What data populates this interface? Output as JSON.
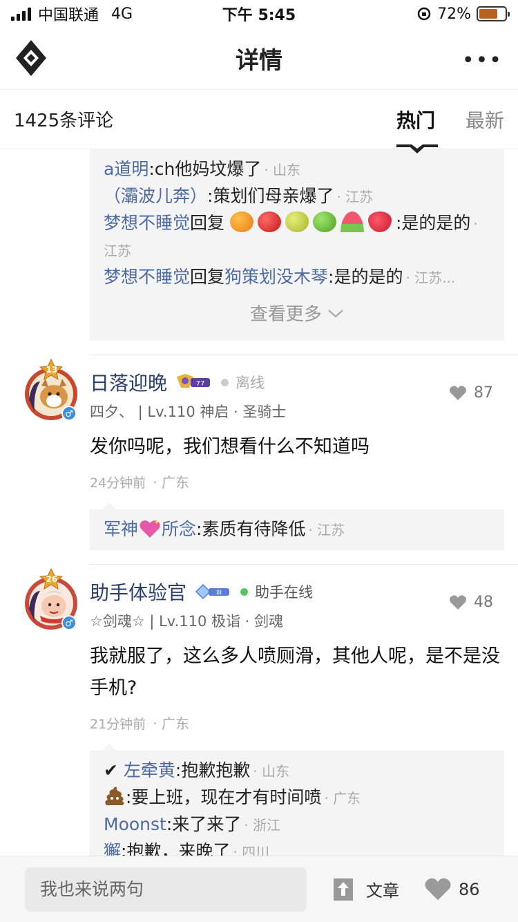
{
  "status_bar": {
    "carrier": "中国联通",
    "network": "4G",
    "time": "下午 5:45",
    "battery_percent": "72%",
    "battery_level": 0.72
  },
  "nav": {
    "title": "详情",
    "more": "•••"
  },
  "comments_header": {
    "count": "1425条评论",
    "tabs": [
      "热门",
      "最新"
    ],
    "active_tab": "热门"
  },
  "prev_replies": {
    "lines": [
      {
        "user": "a道明",
        "text": ":ch他妈坟爆了",
        "loc": "· 山东"
      },
      {
        "user": "（灞波儿奔）",
        "text": ":策划们母亲爆了",
        "loc": "· 江苏"
      },
      {
        "user": "梦想不睡觉",
        "mid": "回复",
        "emojis": [
          "orange",
          "apple",
          "pear",
          "green-apple",
          "watermelon",
          "strawberry"
        ],
        "text": ":是的是的",
        "loc": "· 江苏"
      },
      {
        "user": "梦想不睡觉",
        "mid": "回复",
        "target": "狗策划没木琴",
        "text": ":是的是的",
        "loc": "· 江苏..."
      }
    ],
    "see_more": "查看更多"
  },
  "comments": [
    {
      "avatar_level": "13",
      "name": "日落迎晚",
      "badge": "77",
      "status": "离线",
      "status_color": "#cccccc",
      "rank": "四夕、 | Lv.110 神启 · 圣骑士",
      "likes": "87",
      "content": "发你吗呢，我们想看什么不知道吗",
      "time": "24分钟前",
      "loc": "· 广东",
      "replies": [
        {
          "user": "军神",
          "emoji": "sparkle-heart",
          "user2": "所念",
          "text": ":素质有待降低",
          "loc": "· 江苏"
        }
      ]
    },
    {
      "avatar_level": "26",
      "name": "助手体验官",
      "badge": "III",
      "status": "助手在线",
      "status_color": "#5ac560",
      "rank": "☆剑魂☆ | Lv.110 极诣 · 剑魂",
      "likes": "48",
      "content": "我就服了，这么多人喷厕滑，其他人呢，是不是没手机?",
      "time": "21分钟前",
      "loc": "· 广东",
      "replies": [
        {
          "prefix": "✔",
          "user": "左牵黄",
          "text": ":抱歉抱歉",
          "loc": "· 山东"
        },
        {
          "emoji": "poop",
          "text": ":要上班，现在才有时间喷",
          "loc": "· 广东"
        },
        {
          "user": "Moonst",
          "text": ":来了来了",
          "loc": "· 浙江"
        },
        {
          "user": "獬",
          "text": ":抱歉，来晚了",
          "loc": "· 四川"
        }
      ]
    }
  ],
  "bottom_bar": {
    "input_placeholder": "我也来说两句",
    "article_label": "文章",
    "like_count": "86"
  },
  "colors": {
    "username": "#4d6aa3",
    "accent": "#222222",
    "reply_bg": "#f4f4f5"
  }
}
